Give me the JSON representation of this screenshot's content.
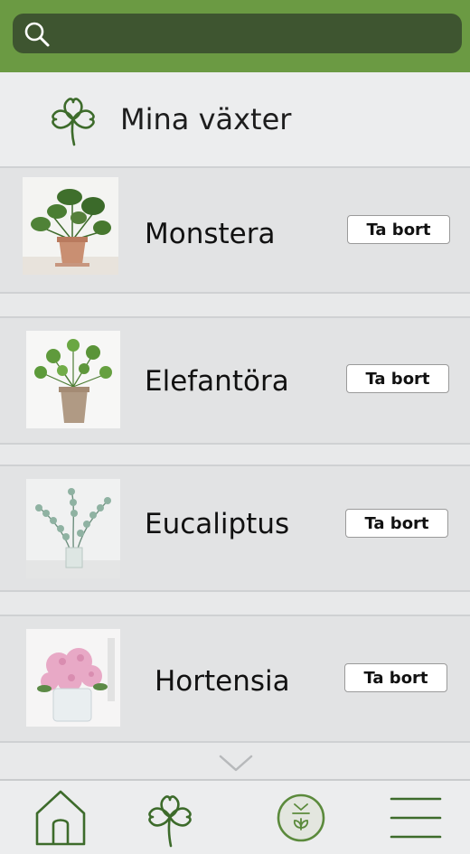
{
  "search": {
    "placeholder": ""
  },
  "header": {
    "title": "Mina växter"
  },
  "plants": [
    {
      "name": "Monstera",
      "remove_label": "Ta bort"
    },
    {
      "name": "Elefantöra",
      "remove_label": "Ta bort"
    },
    {
      "name": "Eucaliptus",
      "remove_label": "Ta bort"
    },
    {
      "name": "Hortensia",
      "remove_label": "Ta bort"
    }
  ],
  "icons": {
    "search": "search-icon",
    "header": "clover-icon",
    "scroll": "chevron-down-icon",
    "nav": [
      "home-icon",
      "clover-icon",
      "sprout-badge-icon",
      "hamburger-menu-icon"
    ]
  },
  "colors": {
    "top_bar": "#6b9a43",
    "search_field": "#3e5530",
    "icon_green": "#3d6b2b",
    "background": "#e8e9ea"
  }
}
